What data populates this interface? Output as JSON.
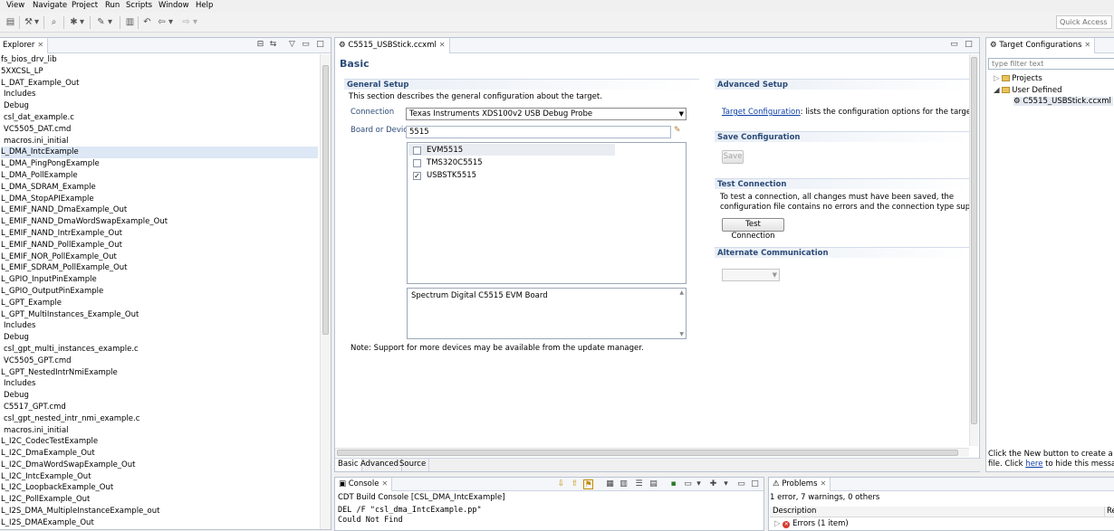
{
  "menu": [
    "View",
    "Navigate",
    "Project",
    "Run",
    "Scripts",
    "Window",
    "Help"
  ],
  "toolbar": {
    "quick_access_placeholder": "Quick Access"
  },
  "explorer": {
    "tab_label": "Explorer",
    "items": [
      "fs_bios_drv_lib",
      "5XXCSL_LP",
      "L_DAT_Example_Out",
      "Includes",
      "Debug",
      "csl_dat_example.c",
      "VC5505_DAT.cmd",
      "macros.ini_initial",
      "L_DMA_IntcExample",
      "L_DMA_PingPongExample",
      "L_DMA_PollExample",
      "L_DMA_SDRAM_Example",
      "L_DMA_StopAPIExample",
      "L_EMIF_NAND_DmaExample_Out",
      "L_EMIF_NAND_DmaWordSwapExample_Out",
      "L_EMIF_NAND_IntrExample_Out",
      "L_EMIF_NAND_PollExample_Out",
      "L_EMIF_NOR_PollExample_Out",
      "L_EMIF_SDRAM_PollExample_Out",
      "L_GPIO_InputPinExample",
      "L_GPIO_OutputPinExample",
      "L_GPT_Example",
      "L_GPT_MultiInstances_Example_Out",
      "Includes",
      "Debug",
      "csl_gpt_multi_instances_example.c",
      "VC5505_GPT.cmd",
      "L_GPT_NestedIntrNmiExample",
      "Includes",
      "Debug",
      "C5517_GPT.cmd",
      "csl_gpt_nested_intr_nmi_example.c",
      "macros.ini_initial",
      "L_I2C_CodecTestExample",
      "L_I2C_DmaExample_Out",
      "L_I2C_DmaWordSwapExample_Out",
      "L_I2C_IntcExample_Out",
      "L_I2C_LoopbackExample_Out",
      "L_I2C_PollExample_Out",
      "L_I2S_DMA_MultipleInstanceExample_out",
      "L_I2S_DMAExample_Out"
    ]
  },
  "editor": {
    "tab_label": "C5515_USBStick.ccxml",
    "title": "Basic",
    "general_setup": {
      "header": "General Setup",
      "description": "This section describes the general configuration about the target.",
      "connection_label": "Connection",
      "connection_value": "Texas Instruments XDS100v2 USB Debug Probe",
      "board_label": "Board or Device",
      "board_value": "5515",
      "devices": [
        {
          "name": "EVM5515",
          "checked": false
        },
        {
          "name": "TMS320C5515",
          "checked": false
        },
        {
          "name": "USBSTK5515",
          "checked": true
        }
      ],
      "device_description": "Spectrum Digital C5515 EVM Board",
      "note": "Note: Support for more devices may be available from the update manager."
    },
    "advanced_setup": {
      "header": "Advanced Setup",
      "link_text": "Target Configuration",
      "link_suffix": ": lists the configuration options for the target."
    },
    "save_configuration": {
      "header": "Save Configuration",
      "button": "Save"
    },
    "test_connection": {
      "header": "Test Connection",
      "line1": "To test a connection, all changes must have been saved, the",
      "line2": "configuration file contains no errors and the connection type supports th",
      "button": "Test Connection"
    },
    "alternate_communication": {
      "header": "Alternate Communication"
    },
    "bottom_tabs": [
      "Basic",
      "Advanced",
      "Source"
    ]
  },
  "targets": {
    "tab_label": "Target Configurations",
    "filter_placeholder": "type filter text",
    "tree": {
      "projects": "Projects",
      "user_defined": "User Defined",
      "file": "C5515_USBStick.ccxml"
    },
    "hint_line1": "Click the New button to create a new",
    "hint_line2_pre": "file. Click ",
    "hint_link": "here",
    "hint_line2_post": " to hide this message."
  },
  "console": {
    "tab_label": "Console",
    "header": "CDT Build Console [CSL_DMA_IntcExample]",
    "lines": [
      "DEL /F \"csl_dma_IntcExample.pp\"",
      "Could Not Find"
    ]
  },
  "problems": {
    "tab_label": "Problems",
    "summary": "1 error, 7 warnings, 0 others",
    "col_description": "Description",
    "col_resource": "Re",
    "row_errors": "Errors (1 item)"
  }
}
